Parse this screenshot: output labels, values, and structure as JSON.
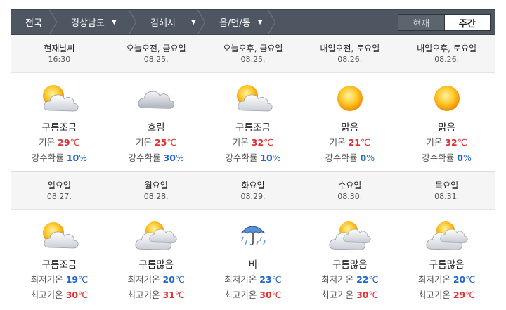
{
  "location": {
    "country": "전국",
    "province": "경상남도",
    "city": "김해시",
    "town": "읍/면/동"
  },
  "view_toggle": {
    "now": "현재",
    "week": "주간",
    "selected": "week"
  },
  "current_row": [
    {
      "title": "현재날씨",
      "date": "16:30",
      "icon": "partly-cloudy-icon",
      "condition": "구름조금",
      "temp_label": "기온",
      "temp": "29",
      "temp_unit": "℃",
      "rain_label": "강수확률",
      "rain": "10",
      "rain_unit": "%"
    },
    {
      "title": "오늘오전, 금요일",
      "date": "08.25.",
      "icon": "cloudy-icon",
      "condition": "흐림",
      "temp_label": "기온",
      "temp": "25",
      "temp_unit": "℃",
      "rain_label": "강수확률",
      "rain": "30",
      "rain_unit": "%"
    },
    {
      "title": "오늘오후, 금요일",
      "date": "08.25.",
      "icon": "partly-cloudy-icon",
      "condition": "구름조금",
      "temp_label": "기온",
      "temp": "32",
      "temp_unit": "℃",
      "rain_label": "강수확률",
      "rain": "10",
      "rain_unit": "%"
    },
    {
      "title": "내일오전, 토요일",
      "date": "08.26.",
      "icon": "sunny-icon",
      "condition": "맑음",
      "temp_label": "기온",
      "temp": "21",
      "temp_unit": "℃",
      "rain_label": "강수확률",
      "rain": "0",
      "rain_unit": "%"
    },
    {
      "title": "내일오후, 토요일",
      "date": "08.26.",
      "icon": "sunny-icon",
      "condition": "맑음",
      "temp_label": "기온",
      "temp": "32",
      "temp_unit": "℃",
      "rain_label": "강수확률",
      "rain": "0",
      "rain_unit": "%"
    }
  ],
  "weekly_row": [
    {
      "title": "일요일",
      "date": "08.27.",
      "icon": "partly-cloudy-icon",
      "condition": "구름조금",
      "min_label": "최저기온",
      "min": "19",
      "max_label": "최고기온",
      "max": "30",
      "unit": "℃"
    },
    {
      "title": "월요일",
      "date": "08.28.",
      "icon": "mostly-cloudy-icon",
      "condition": "구름많음",
      "min_label": "최저기온",
      "min": "20",
      "max_label": "최고기온",
      "max": "31",
      "unit": "℃"
    },
    {
      "title": "화요일",
      "date": "08.29.",
      "icon": "rain-icon",
      "condition": "비",
      "min_label": "최저기온",
      "min": "23",
      "max_label": "최고기온",
      "max": "30",
      "unit": "℃"
    },
    {
      "title": "수요일",
      "date": "08.30.",
      "icon": "mostly-cloudy-icon",
      "condition": "구름많음",
      "min_label": "최저기온",
      "min": "22",
      "max_label": "최고기온",
      "max": "30",
      "unit": "℃"
    },
    {
      "title": "목요일",
      "date": "08.31.",
      "icon": "mostly-cloudy-icon",
      "condition": "구름많음",
      "min_label": "최저기온",
      "min": "20",
      "max_label": "최고기온",
      "max": "29",
      "unit": "℃"
    }
  ],
  "colors": {
    "header_bg": "#4e5661",
    "temp_red": "#e03030",
    "rain_blue": "#2266cc"
  }
}
